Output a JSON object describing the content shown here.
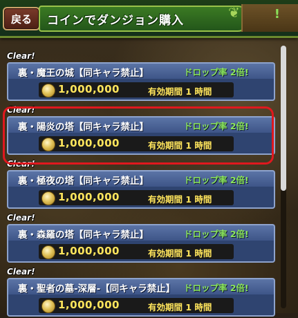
{
  "header": {
    "back_label": "戻る",
    "title": "コインでダンジョン購入",
    "excl": "!"
  },
  "items": [
    {
      "clear": "Clear!",
      "name": "裏・魔王の城【同キャラ禁止】",
      "rate": "ドロップ率 2倍!",
      "price": "1,000,000",
      "period": "有効期間 1 時間"
    },
    {
      "clear": "Clear!",
      "name": "裏・陽炎の塔【同キャラ禁止】",
      "rate": "ドロップ率 2倍!",
      "price": "1,000,000",
      "period": "有効期間 1 時間"
    },
    {
      "clear": "Clear!",
      "name": "裏・極夜の塔【同キャラ禁止】",
      "rate": "ドロップ率 2倍!",
      "price": "1,000,000",
      "period": "有効期間 1 時間"
    },
    {
      "clear": "Clear!",
      "name": "裏・森羅の塔【同キャラ禁止】",
      "rate": "ドロップ率 2倍!",
      "price": "1,000,000",
      "period": "有効期間 1 時間"
    },
    {
      "clear": "Clear!",
      "name": "裏・聖者の墓-深層-【同キャラ禁止】",
      "rate": "ドロップ率 2倍!",
      "price": "1,000,000",
      "period": "有効期間 1 時間"
    }
  ],
  "selected_index": 1,
  "colors": {
    "accent_green": "#8be65a",
    "price_yellow": "#ffe55c",
    "selection_red": "#e0181e"
  },
  "icons": [
    "back-icon",
    "leaf-icon",
    "coin-icon"
  ]
}
